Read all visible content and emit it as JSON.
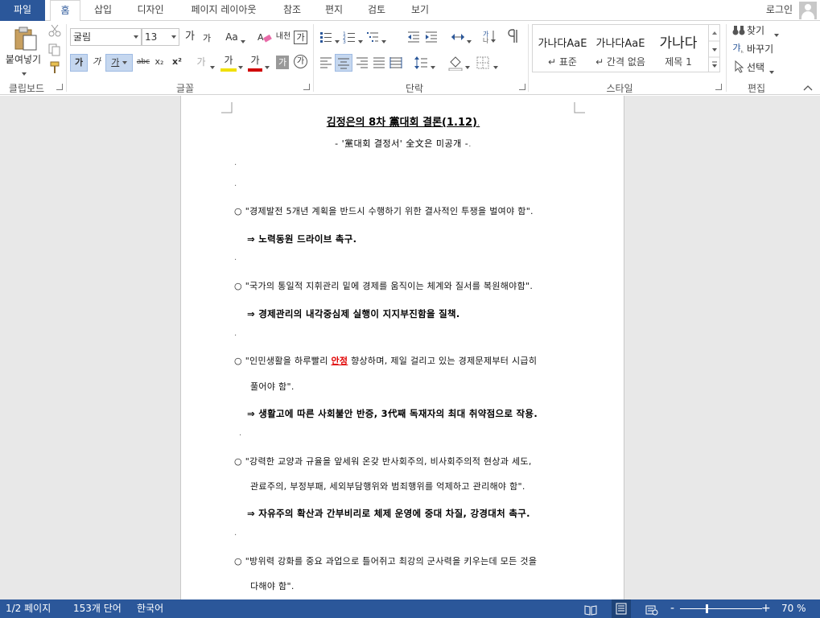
{
  "tabs": {
    "file": "파일",
    "home": "홈",
    "insert": "삽입",
    "design": "디자인",
    "layout": "페이지 레이아웃",
    "references": "참조",
    "mailings": "편지",
    "review": "검토",
    "view": "보기"
  },
  "account": {
    "login": "로그인"
  },
  "ribbon": {
    "clipboard": {
      "paste": "붙여넣기",
      "label": "클립보드"
    },
    "font": {
      "name": "굴림",
      "size": "13",
      "grow": "가",
      "shrink": "가",
      "case": "Aa",
      "phonetic": "내천",
      "border_char": "가",
      "bold": "가",
      "italic": "가",
      "underline": "가",
      "strike": "abc",
      "sub": "x₂",
      "sup": "x²",
      "effects": "가",
      "highlight": "가",
      "color": "가",
      "shading": "가",
      "enclose": "가",
      "label": "글꼴"
    },
    "paragraph": {
      "label": "단락"
    },
    "styles": {
      "items": [
        {
          "sample": "가나다AaE",
          "name": "↵ 표준"
        },
        {
          "sample": "가나다AaE",
          "name": "↵ 간격 없음"
        },
        {
          "sample": "가나다",
          "name": "제목 1"
        }
      ],
      "label": "스타일"
    },
    "editing": {
      "find": "찾기",
      "replace": "바꾸기",
      "select": "선택",
      "label": "편집"
    }
  },
  "document": {
    "title": "김정은의 8차 黨대회 결론(1.12)",
    "title_mark": "↵",
    "subtitle": "- '黨대회 결정서' 全文은 미공개 -",
    "mark": ".",
    "items": [
      {
        "text": "○ \"경제발전 5개년 계획을 반드시 수행하기 위한 결사적인 투쟁을 벌여야 함\"."
      },
      {
        "text": "⇒ 노력동원 드라이브 촉구."
      },
      {
        "text": "○ \"국가의 통일적 지휘관리 밑에 경제를 움직이는 체계와 질서를 복원해야함\"."
      },
      {
        "text": "⇒ 경제관리의 내각중심제 실행이 지지부진함을 질책."
      },
      {
        "pre": "○ \"인민생활을 하루빨리 ",
        "highlight": "안정",
        "post": " 향상하며, 제일 걸리고 있는 경제문제부터 시급히"
      },
      {
        "text": "풀어야 함\"."
      },
      {
        "text": "⇒ 생활고에 따른 사회불안 반증, 3代째 독재자의 최대 취약점으로 작용."
      },
      {
        "text": "○ \"강력한 교양과 규율을 앞세워 온갖 반사회주의, 비사회주의적 현상과 세도,"
      },
      {
        "text": "관료주의, 부정부패, 세외부담행위와 범죄행위를 억제하고 관리해야 함\"."
      },
      {
        "text": "⇒ 자유주의 확산과 간부비리로 체제 운영에 중대 차질, 강경대처 촉구."
      },
      {
        "text": "○ \"방위력 강화를 중요 과업으로 틀어쥐고 최강의 군사력을 키우는데 모든 것을"
      },
      {
        "text": "다해야 함\"."
      }
    ]
  },
  "status": {
    "page": "1/2 페이지",
    "words": "153개 단어",
    "language": "한국어",
    "zoom": "70 %",
    "zoom_minus": "-",
    "zoom_plus": "+"
  },
  "colors": {
    "accent": "#2b579a",
    "highlight_text": "#e00000"
  }
}
